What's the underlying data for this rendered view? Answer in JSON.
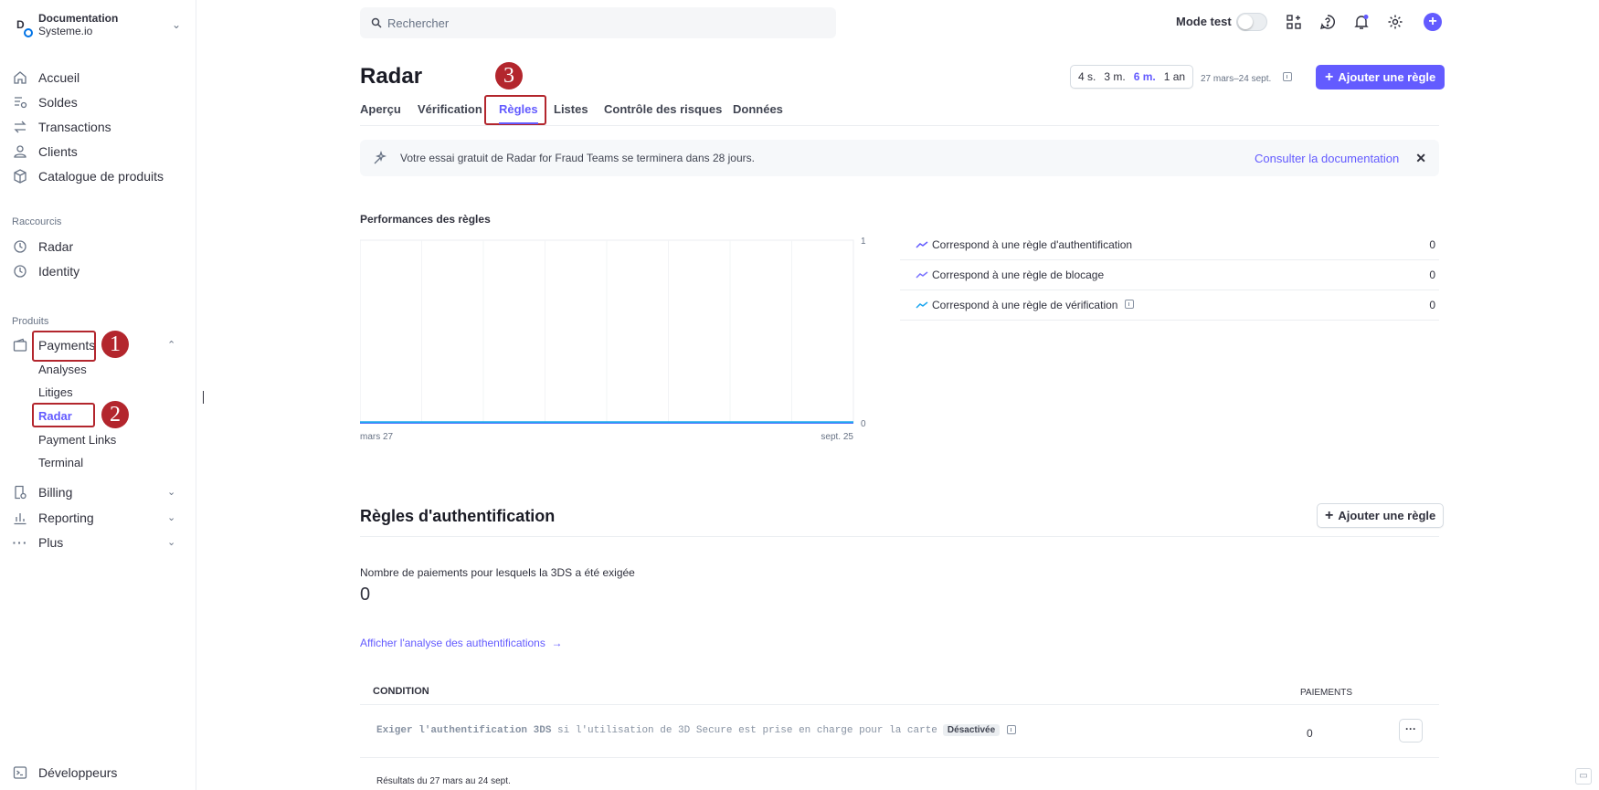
{
  "account": {
    "initial": "D",
    "name": "Documentation",
    "subtitle": "Systeme.io"
  },
  "sidebar": {
    "items": [
      {
        "label": "Accueil",
        "icon": "home-icon"
      },
      {
        "label": "Soldes",
        "icon": "balance-icon"
      },
      {
        "label": "Transactions",
        "icon": "transactions-icon"
      },
      {
        "label": "Clients",
        "icon": "user-icon"
      },
      {
        "label": "Catalogue de produits",
        "icon": "box-icon"
      }
    ],
    "shortcuts_label": "Raccourcis",
    "shortcuts": [
      {
        "label": "Radar",
        "icon": "clock-icon"
      },
      {
        "label": "Identity",
        "icon": "clock-icon"
      }
    ],
    "products_label": "Produits",
    "payments_label": "Payments",
    "payments_sub": [
      "Analyses",
      "Litiges",
      "Radar",
      "Payment Links",
      "Terminal"
    ],
    "billing_label": "Billing",
    "reporting_label": "Reporting",
    "plus_label": "Plus",
    "developers_label": "Développeurs"
  },
  "callouts": [
    "1",
    "2",
    "3"
  ],
  "search": {
    "placeholder": "Rechercher"
  },
  "topbar": {
    "test_mode_label": "Mode test"
  },
  "header": {
    "title": "Radar",
    "periods": [
      "4 s.",
      "3 m.",
      "6 m.",
      "1 an"
    ],
    "selected_period": "6 m.",
    "date_range": "27 mars–24 sept.",
    "add_rule": "Ajouter une règle"
  },
  "tabs": [
    "Aperçu",
    "Vérification",
    "Règles",
    "Listes",
    "Contrôle des risques",
    "Données"
  ],
  "active_tab": "Règles",
  "banner": {
    "text": "Votre essai gratuit de Radar for Fraud Teams se terminera dans 28 jours.",
    "link": "Consulter la documentation"
  },
  "chart_data": {
    "type": "line",
    "title": "Performances des règles",
    "x": [
      "mars 27",
      "sept. 25"
    ],
    "ylim": [
      0,
      1
    ],
    "ytick_labels": [
      "1",
      "0"
    ],
    "grid": true,
    "legend_placement": "right",
    "series": [
      {
        "name": "Correspond à une règle d'authentification",
        "values": [
          0,
          0
        ],
        "total": "0",
        "color": "#635bff"
      },
      {
        "name": "Correspond à une règle de blocage",
        "values": [
          0,
          0
        ],
        "total": "0",
        "color": "#7a73ff"
      },
      {
        "name": "Correspond à une règle de vérification",
        "values": [
          0,
          0
        ],
        "total": "0",
        "color": "#1ea7ef"
      }
    ]
  },
  "auth_rules": {
    "title": "Règles d'authentification",
    "add_rule": "Ajouter une règle",
    "metric_label": "Nombre de paiements pour lesquels la 3DS a été exigée",
    "metric_value": "0",
    "analysis_link": "Afficher l'analyse des authentifications",
    "table": {
      "headers": [
        "CONDITION",
        "PAIEMENTS"
      ],
      "rows": [
        {
          "cond_pre": "Exiger l'authentification 3DS",
          "cond_post": " si l'utilisation de 3D Secure est prise en charge pour la carte",
          "badge": "Désactivée",
          "payments": "0",
          "more": "···"
        }
      ]
    },
    "results": "Résultats du 27 mars au 24 sept."
  }
}
